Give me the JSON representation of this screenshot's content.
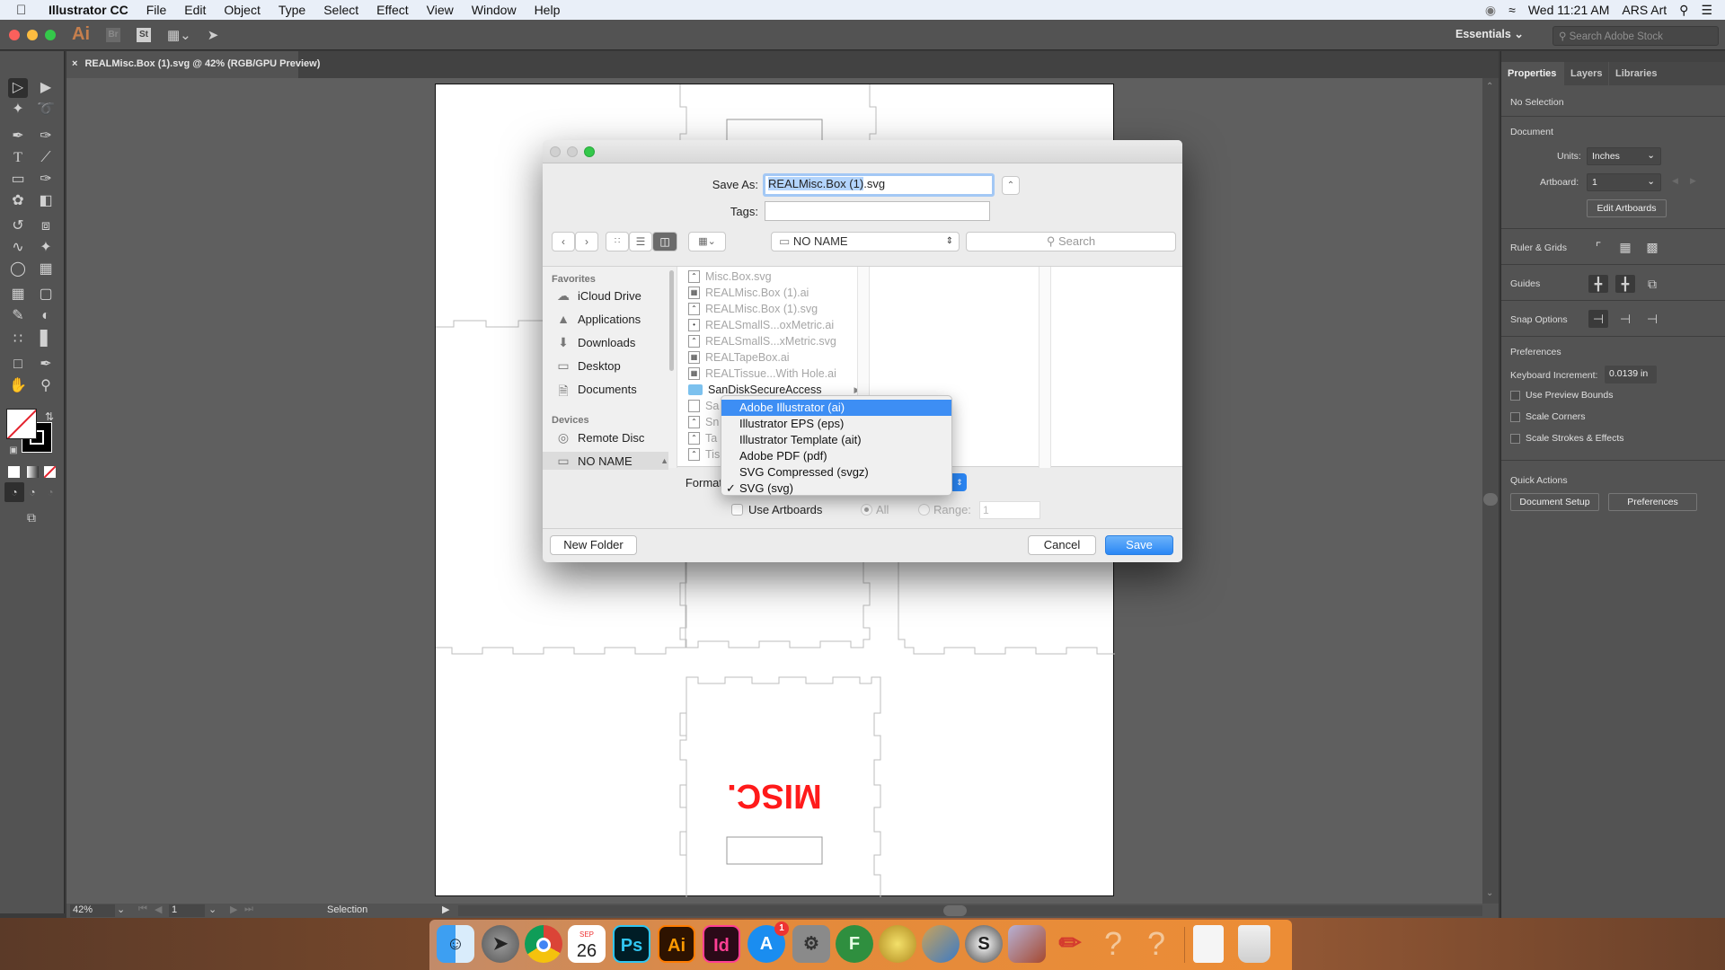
{
  "menubar": {
    "app_name": "Illustrator CC",
    "items": [
      "File",
      "Edit",
      "Object",
      "Type",
      "Select",
      "Effect",
      "View",
      "Window",
      "Help"
    ],
    "clock": "Wed 11:21 AM",
    "user": "ARS Art"
  },
  "appbar": {
    "logo": "Ai",
    "bridge": "Br",
    "stock": "St",
    "workspace": "Essentials",
    "stock_search_placeholder": "Search Adobe Stock"
  },
  "document_tab": {
    "title": "REALMisc.Box (1).svg @ 42% (RGB/GPU Preview)"
  },
  "artboard": {
    "label_text": "MISC.",
    "label_color": "#ff0000"
  },
  "statusbar": {
    "zoom": "42%",
    "artboard": "1",
    "tool": "Selection"
  },
  "right_panel": {
    "tabs": [
      "Properties",
      "Layers",
      "Libraries"
    ],
    "active_tab": "Properties",
    "selection": "No Selection",
    "document_heading": "Document",
    "units_label": "Units:",
    "units_value": "Inches",
    "artboard_label": "Artboard:",
    "artboard_value": "1",
    "edit_artboards": "Edit Artboards",
    "ruler_grids": "Ruler & Grids",
    "guides": "Guides",
    "snap_options": "Snap Options",
    "preferences_heading": "Preferences",
    "keyboard_increment_label": "Keyboard Increment:",
    "keyboard_increment_value": "0.0139 in",
    "checkboxes": [
      {
        "label": "Use Preview Bounds",
        "checked": false
      },
      {
        "label": "Scale Corners",
        "checked": false
      },
      {
        "label": "Scale Strokes & Effects",
        "checked": false
      }
    ],
    "quick_actions": "Quick Actions",
    "document_setup": "Document Setup",
    "preferences_button": "Preferences"
  },
  "save_dialog": {
    "save_as_label": "Save As:",
    "filename_selected": "REALMisc.Box (1)",
    "filename_ext": ".svg",
    "tags_label": "Tags:",
    "tags_value": "",
    "location": "NO NAME",
    "search_placeholder": "Search",
    "sidebar": {
      "favorites_heading": "Favorites",
      "favorites": [
        "iCloud Drive",
        "Applications",
        "Downloads",
        "Desktop",
        "Documents"
      ],
      "devices_heading": "Devices",
      "devices": [
        "Remote Disc",
        "NO NAME"
      ]
    },
    "files": [
      {
        "name": "Misc.Box.svg",
        "kind": "svg"
      },
      {
        "name": "REALMisc.Box (1).ai",
        "kind": "ai"
      },
      {
        "name": "REALMisc.Box (1).svg",
        "kind": "svg"
      },
      {
        "name": "REALSmallS...oxMetric.ai",
        "kind": "ai"
      },
      {
        "name": "REALSmallS...xMetric.svg",
        "kind": "svg"
      },
      {
        "name": "REALTapeBox.ai",
        "kind": "ai"
      },
      {
        "name": "REALTissue...With Hole.ai",
        "kind": "ai"
      },
      {
        "name": "SanDiskSecureAccess",
        "kind": "folder"
      },
      {
        "name": "Sa",
        "kind": "doc"
      },
      {
        "name": "Sn",
        "kind": "svg"
      },
      {
        "name": "Ta",
        "kind": "svg"
      },
      {
        "name": "Tis",
        "kind": "svg"
      }
    ],
    "format_label": "Format",
    "format_options": [
      "Adobe Illustrator (ai)",
      "Illustrator EPS (eps)",
      "Illustrator Template (ait)",
      "Adobe PDF (pdf)",
      "SVG Compressed (svgz)",
      "SVG (svg)"
    ],
    "format_highlighted": "Adobe Illustrator (ai)",
    "format_checked": "SVG (svg)",
    "use_artboards": "Use Artboards",
    "all_label": "All",
    "range_label": "Range:",
    "range_value": "1",
    "new_folder": "New Folder",
    "cancel": "Cancel",
    "save": "Save"
  },
  "dock": {
    "apps": [
      "Finder",
      "Launchpad",
      "Chrome",
      "Calendar",
      "Photoshop",
      "Illustrator",
      "InDesign",
      "App Store",
      "System Preferences",
      "F2",
      "Sphere",
      "Terrain",
      "Sketchup",
      "Polyhedron",
      "Pencil",
      "Unknown",
      "Unknown",
      "Documents",
      "Trash"
    ],
    "calendar_month": "SEP",
    "calendar_day": "26",
    "appstore_badge": "1"
  }
}
